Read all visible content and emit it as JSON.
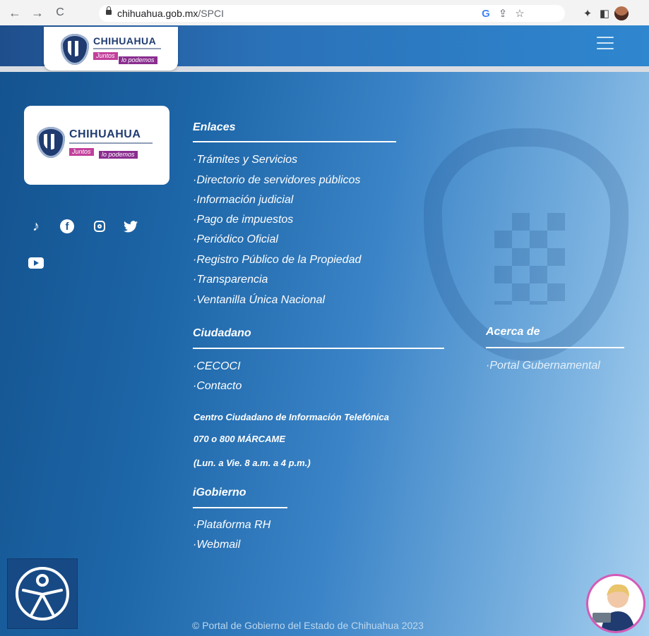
{
  "browser": {
    "url_domain": "chihuahua.gob.mx",
    "url_path": "/SPCI",
    "nav": {
      "back": "←",
      "forward": "→",
      "reload": "C"
    },
    "icons": [
      "google-g-icon",
      "share-icon",
      "star-icon",
      "extensions-icon",
      "sidepanel-icon",
      "profile-avatar-icon"
    ]
  },
  "header": {
    "logo": {
      "name": "CHIHUAHUA",
      "tag_a": "Juntos",
      "tag_b": "lo podemos"
    },
    "menu_icon": "hamburger-menu-icon"
  },
  "footer_logo": {
    "name": "CHIHUAHUA",
    "tag_a": "Juntos",
    "tag_b": "lo podemos"
  },
  "social": [
    "tiktok-icon",
    "facebook-icon",
    "instagram-icon",
    "twitter-icon",
    "youtube-icon"
  ],
  "enlaces": {
    "title": "Enlaces",
    "links": [
      "·Trámites y Servicios",
      "·Directorio de servidores públicos",
      "·Información judicial",
      "·Pago de impuestos",
      "·Periódico Oficial",
      "·Registro Público de la Propiedad",
      "·Transparencia",
      "·Ventanilla Única Nacional"
    ]
  },
  "ciudadano": {
    "title": "Ciudadano",
    "links": [
      "·CECOCI",
      "·Contacto"
    ],
    "info": [
      "Centro Ciudadano de Información Telefónica",
      "070 o 800 MÁRCAME",
      "(Lun. a Vie. 8 a.m. a 4 p.m.)"
    ]
  },
  "acerca": {
    "title": "Acerca de",
    "links": [
      "·Portal Gubernamental"
    ]
  },
  "igobierno": {
    "title": "iGobierno",
    "links": [
      "·Plataforma RH",
      "·Webmail"
    ]
  },
  "copyright": "© Portal de Gobierno del Estado de Chihuahua 2023",
  "colors": {
    "footer_start": "#14538f",
    "footer_end": "#a8d0ef",
    "accent_purple": "#8a2d8f",
    "text": "#ffffff"
  }
}
